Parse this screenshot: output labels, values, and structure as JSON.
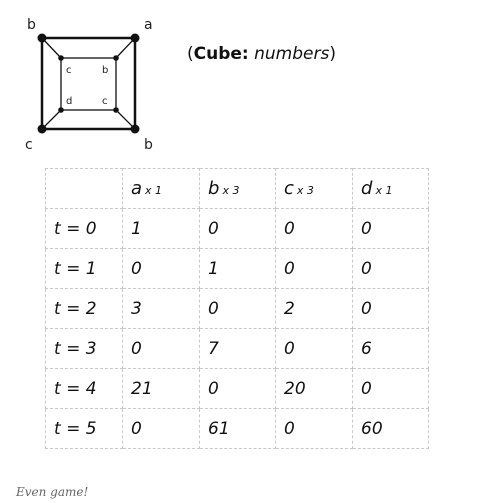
{
  "diagram": {
    "outer_labels": [
      "b",
      "a",
      "c",
      "b"
    ],
    "inner_labels": [
      "c",
      "b",
      "d",
      "c"
    ]
  },
  "caption": {
    "open_paren": "(",
    "bold": "Cube:",
    "italic": "numbers",
    "close_paren": ")"
  },
  "table": {
    "header": [
      {
        "name": "",
        "mult": ""
      },
      {
        "name": "a",
        "mult": "x 1"
      },
      {
        "name": "b",
        "mult": "x 3"
      },
      {
        "name": "c",
        "mult": "x 3"
      },
      {
        "name": "d",
        "mult": "x 1"
      }
    ],
    "rows": [
      [
        "t = 0",
        "1",
        "0",
        "0",
        "0"
      ],
      [
        "t = 1",
        "0",
        "1",
        "0",
        "0"
      ],
      [
        "t = 2",
        "3",
        "0",
        "2",
        "0"
      ],
      [
        "t = 3",
        "0",
        "7",
        "0",
        "6"
      ],
      [
        "t = 4",
        "21",
        "0",
        "20",
        "0"
      ],
      [
        "t = 5",
        "0",
        "61",
        "0",
        "60"
      ]
    ]
  },
  "footer": "Even game!"
}
